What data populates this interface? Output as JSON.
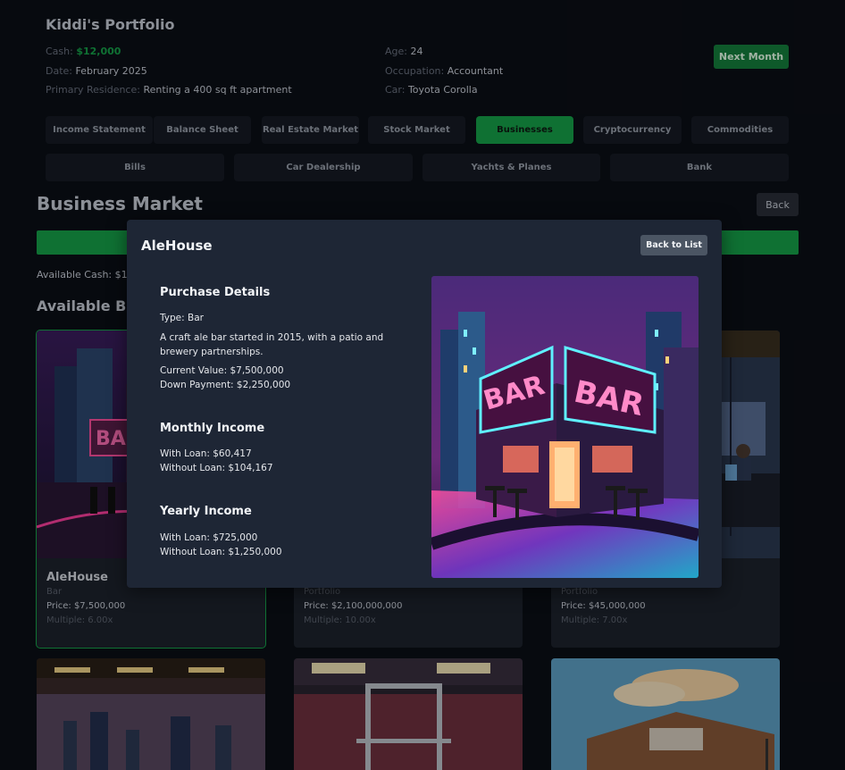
{
  "header": {
    "title": "Kiddi's Portfolio",
    "cash_label": "Cash: ",
    "cash_value": "$12,000",
    "date_label": "Date: ",
    "date_value": "February 2025",
    "residence_label": "Primary Residence: ",
    "residence_value": "Renting a 400 sq ft apartment",
    "age_label": "Age: ",
    "age_value": "24",
    "occupation_label": "Occupation: ",
    "occupation_value": "Accountant",
    "car_label": "Car: ",
    "car_value": "Toyota Corolla",
    "next_month": "Next Month"
  },
  "tabs_row1": [
    "Income Statement",
    "Balance Sheet",
    "Real Estate Market",
    "Stock Market",
    "Businesses",
    "Cryptocurrency",
    "Commodities"
  ],
  "tabs_row2": [
    "Bills",
    "Car Dealership",
    "Yachts & Planes",
    "Bank"
  ],
  "active_tab": "Businesses",
  "market": {
    "heading": "Business Market",
    "back": "Back",
    "available_cash": "Available Cash: $12",
    "available_heading": "Available Bu"
  },
  "cards": [
    {
      "name": "AleHouse",
      "type": "Bar",
      "price": "Price: $7,500,000",
      "multiple": "Multiple: 6.00x"
    },
    {
      "name": "",
      "type": "Portfolio",
      "price": "Price: $2,100,000,000",
      "multiple": "Multiple: 10.00x"
    },
    {
      "name": "",
      "type": "Portfolio",
      "price": "Price: $45,000,000",
      "multiple": "Multiple: 7.00x"
    }
  ],
  "modal": {
    "title": "AleHouse",
    "back_to_list": "Back to List",
    "purchase_heading": "Purchase Details",
    "type": "Type: Bar",
    "description": "A craft ale bar started in 2015, with a patio and brewery partnerships.",
    "current_value": "Current Value: $7,500,000",
    "down_payment": "Down Payment: $2,250,000",
    "monthly_heading": "Monthly Income",
    "monthly_with_loan": "With Loan: $60,417",
    "monthly_without_loan": "Without Loan: $104,167",
    "yearly_heading": "Yearly Income",
    "yearly_with_loan": "With Loan: $725,000",
    "yearly_without_loan": "Without Loan: $1,250,000",
    "sign_text": "BAR"
  },
  "colors": {
    "accent": "#16a34a",
    "background": "#0b0f16",
    "modal": "#1e2635"
  }
}
